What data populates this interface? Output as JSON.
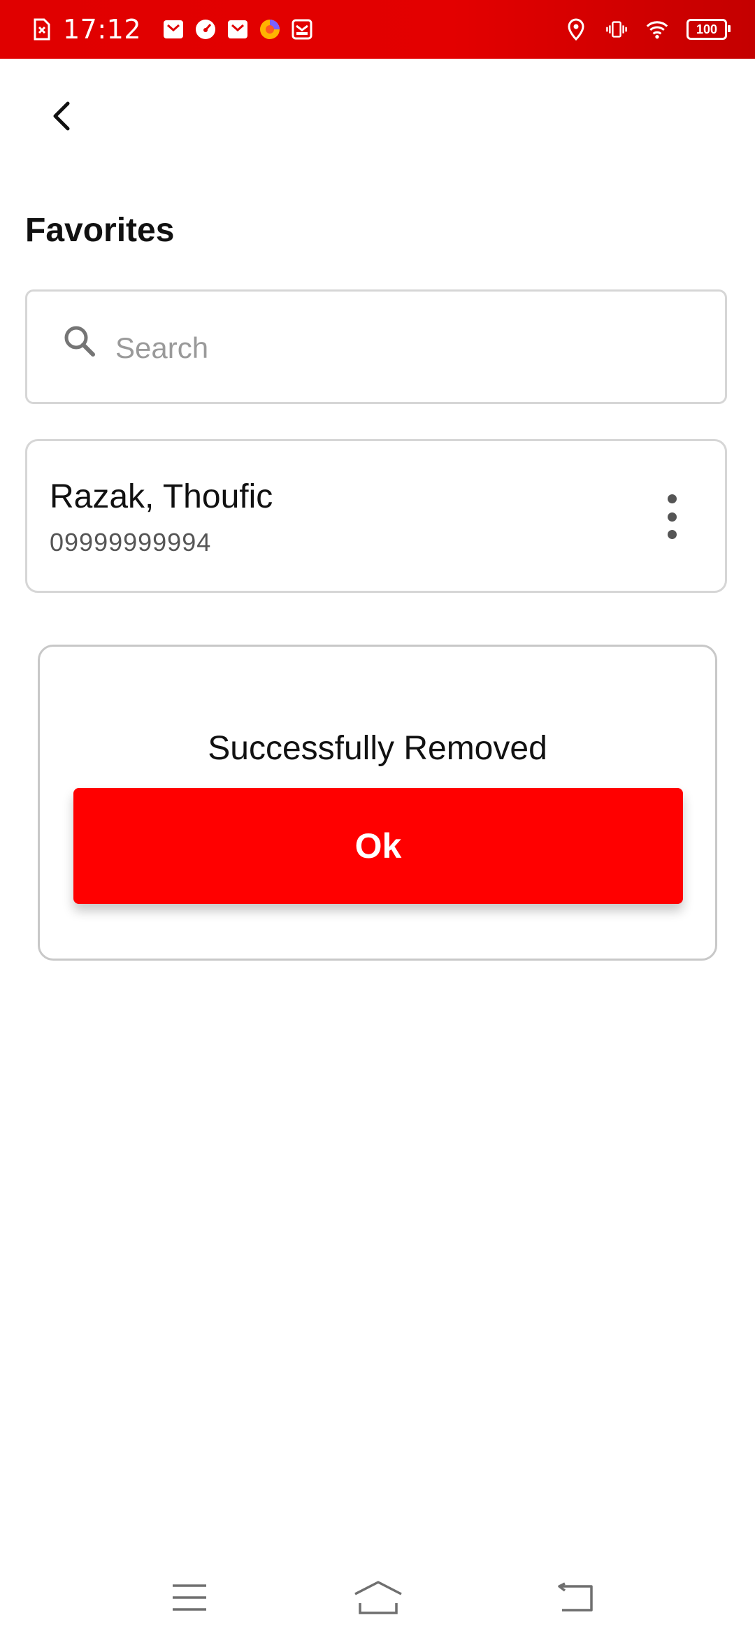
{
  "status_bar": {
    "time": "17:12",
    "battery_level": "100",
    "notification_icons": [
      "sim-off-icon",
      "mail-icon",
      "speedometer-icon",
      "mail-icon",
      "browser-icon",
      "inbox-icon"
    ],
    "system_icons": [
      "location-icon",
      "vibrate-icon",
      "wifi-icon",
      "battery-icon"
    ],
    "background_color": "#e00000"
  },
  "header": {
    "back_icon": "chevron-left-icon",
    "title": "Favorites"
  },
  "search": {
    "placeholder": "Search",
    "value": ""
  },
  "favorites": [
    {
      "name": "Razak, Thoufic",
      "phone": "09999999994"
    }
  ],
  "dialog": {
    "message": "Successfully Removed",
    "ok_label": "Ok",
    "button_color": "#ff0000"
  },
  "nav_bar": {
    "items": [
      "menu-icon",
      "home-icon",
      "back-icon"
    ]
  }
}
